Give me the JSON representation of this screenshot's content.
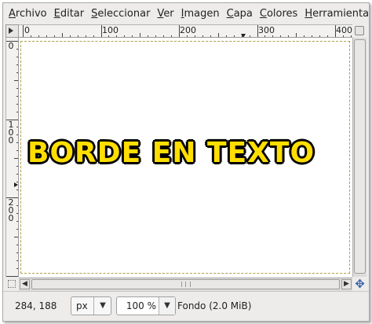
{
  "menubar": {
    "items": [
      "Archivo",
      "Editar",
      "Seleccionar",
      "Ver",
      "Imagen",
      "Capa",
      "Colores",
      "Herramientas"
    ]
  },
  "ruler": {
    "horizontal_labels": [
      "0",
      "100",
      "200",
      "300",
      "400"
    ],
    "vertical_labels": [
      "0",
      "100",
      "200"
    ]
  },
  "canvas": {
    "text": "BORDE EN TEXTO",
    "text_color": "#ffde00",
    "outline_color": "#000000",
    "background": "#ffffff"
  },
  "statusbar": {
    "coordinates": "284, 188",
    "unit": "px",
    "zoom": "100 %",
    "layer_info": "Fondo (2.0 MiB)"
  },
  "icons": {
    "menu_toggle": "triangle-right-icon",
    "quick_mask": "quick-mask-icon",
    "navigate": "four-way-arrow-icon",
    "zoom_to_fit": "zoom-fit-icon",
    "dropdown": "chevron-down-icon"
  }
}
